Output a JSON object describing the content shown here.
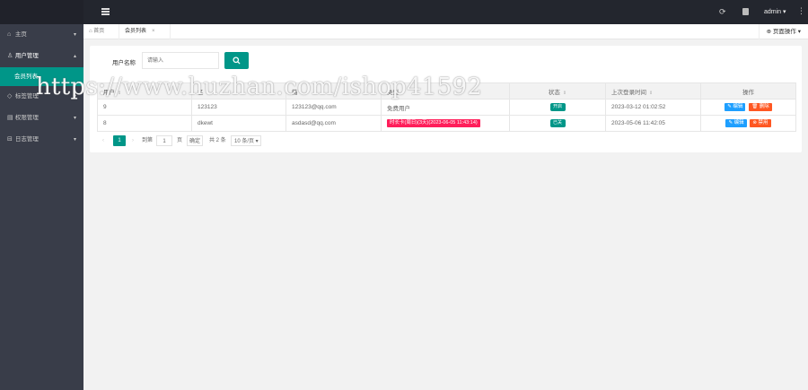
{
  "topbar": {
    "menu_icon": "menu-icon",
    "refresh_icon": "refresh-icon",
    "refresh_glyph": "⟳",
    "skin_icon": "skin-icon",
    "user": "admin ▾",
    "more_glyph": "⋮"
  },
  "sidebar": {
    "items": [
      {
        "icon": "⌂",
        "label": "主页",
        "arrow": "▾"
      },
      {
        "icon": "♙",
        "label": "用户管理",
        "arrow": "▴"
      },
      {
        "icon": "◇",
        "label": "标签管理",
        "arrow": "▾"
      },
      {
        "icon": "▤",
        "label": "权限管理",
        "arrow": "▾"
      },
      {
        "icon": "⊟",
        "label": "日志管理",
        "arrow": "▾"
      }
    ],
    "sub_active": "会员列表"
  },
  "tabs": {
    "home": "⌂ 首页",
    "active": "会员列表",
    "close": "×",
    "page_ops": "⊕ 页面操作 ▾"
  },
  "search": {
    "label": "用户名称",
    "placeholder": "请输入"
  },
  "table": {
    "headers": [
      "用户",
      "名",
      "箱",
      "类型",
      "状态",
      "上次登录时间",
      "操作"
    ],
    "sort_glyph": "⇕",
    "rows": [
      {
        "id": "9",
        "name": "123123",
        "email": "123123@qq.com",
        "type": "免费用户",
        "status": "开启",
        "last_login": "2023-03-12 01:02:52",
        "edit": "✎ 编辑",
        "del": "🗑 删除"
      },
      {
        "id": "8",
        "name": "dkewt",
        "email": "asdasd@qq.com",
        "type": "时长卡(周日)(3天)(2023-06-05 11:43:14)",
        "status": "已关",
        "last_login": "2023-05-06 11:42:05",
        "edit": "✎ 编辑",
        "del": "⊗ 禁用"
      }
    ]
  },
  "pager": {
    "prev": "‹",
    "current": "1",
    "next": "›",
    "to": "到第",
    "page_input": "1",
    "unit": "页",
    "go": "确定",
    "total": "共 2 条",
    "size": "10 条/页 ▾"
  },
  "watermark": "https://www.huzhan.com/ishop41592",
  "colors": {
    "accent": "#009688",
    "sidebar_bg": "#393d49",
    "topbar_bg": "#23262e",
    "badge_red": "#ff1e5a",
    "edit_blue": "#1e9fff",
    "delete_orange": "#ff5722"
  }
}
